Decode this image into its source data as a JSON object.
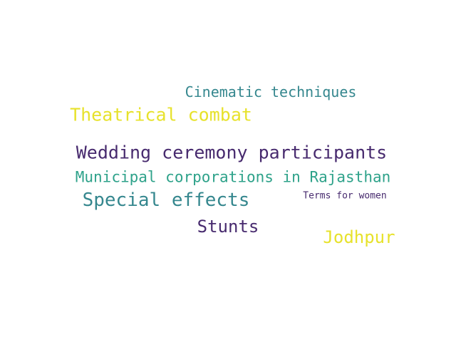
{
  "colors": {
    "background": "#ffffff",
    "dark_purple": "#472a6e",
    "teal": "#35878e",
    "green_teal": "#2ea28a",
    "yellow": "#e7e22c"
  },
  "words": [
    {
      "id": "cinematic-techniques",
      "text": "Cinematic techniques",
      "color": "#35878e"
    },
    {
      "id": "theatrical-combat",
      "text": "Theatrical combat",
      "color": "#e7e22c"
    },
    {
      "id": "wedding-ceremony-participants",
      "text": "Wedding ceremony participants",
      "color": "#472a6e"
    },
    {
      "id": "municipal-corporations-in-rajasthan",
      "text": "Municipal corporations in Rajasthan",
      "color": "#2ea28a"
    },
    {
      "id": "special-effects",
      "text": "Special effects",
      "color": "#35878e"
    },
    {
      "id": "terms-for-women",
      "text": "Terms for women",
      "color": "#472a6e"
    },
    {
      "id": "stunts",
      "text": "Stunts",
      "color": "#472a6e"
    },
    {
      "id": "jodhpur",
      "text": "Jodhpur",
      "color": "#e7e22c"
    }
  ]
}
